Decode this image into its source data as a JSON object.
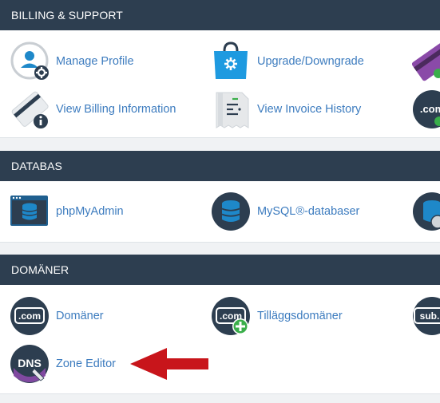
{
  "billing": {
    "title": "BILLING & SUPPORT",
    "items": [
      {
        "label": "Manage Profile",
        "icon": "user-profile-icon"
      },
      {
        "label": "Upgrade/Downgrade",
        "icon": "upgrade-bag-icon"
      },
      {
        "label": "View Billing Information",
        "icon": "billing-card-icon"
      },
      {
        "label": "View Invoice History",
        "icon": "invoice-receipt-icon"
      }
    ]
  },
  "database": {
    "title": "DATABAS",
    "items": [
      {
        "label": "phpMyAdmin",
        "icon": "phpmyadmin-icon"
      },
      {
        "label": "MySQL®-databaser",
        "icon": "mysql-database-icon"
      }
    ]
  },
  "domains": {
    "title": "DOMÄNER",
    "items": [
      {
        "label": "Domäner",
        "icon": "domains-icon",
        "badge": ".com"
      },
      {
        "label": "Tilläggsdomäner",
        "icon": "addon-domains-icon",
        "badge": ".com"
      },
      {
        "label": "Zone Editor",
        "icon": "dns-zone-icon",
        "badge": "DNS"
      }
    ],
    "partial_badge": "sub."
  },
  "partial": {
    "badge_com": ".com"
  },
  "colors": {
    "header": "#2d3e50",
    "link": "#3d7cbf",
    "arrow": "#c8151b",
    "accent_blue": "#1e88c9"
  }
}
